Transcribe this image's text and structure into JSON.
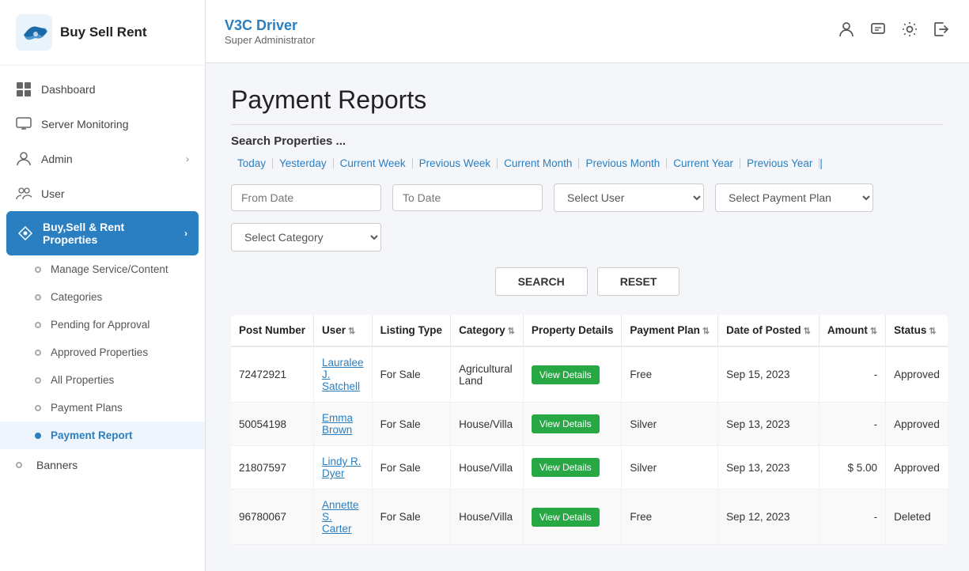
{
  "sidebar": {
    "logo_text": "Buy Sell Rent",
    "nav_items": [
      {
        "id": "dashboard",
        "label": "Dashboard",
        "icon": "grid"
      },
      {
        "id": "server-monitoring",
        "label": "Server Monitoring",
        "icon": "monitor"
      },
      {
        "id": "admin",
        "label": "Admin",
        "icon": "person",
        "has_arrow": true
      },
      {
        "id": "user",
        "label": "User",
        "icon": "people"
      },
      {
        "id": "buy-sell-rent",
        "label": "Buy,Sell & Rent Properties",
        "icon": "tag",
        "active": true,
        "has_arrow": true
      }
    ],
    "sub_items": [
      {
        "id": "manage-service",
        "label": "Manage Service/Content"
      },
      {
        "id": "categories",
        "label": "Categories"
      },
      {
        "id": "pending-approval",
        "label": "Pending for Approval"
      },
      {
        "id": "approved-properties",
        "label": "Approved Properties"
      },
      {
        "id": "all-properties",
        "label": "All Properties"
      },
      {
        "id": "payment-plans",
        "label": "Payment Plans"
      },
      {
        "id": "payment-report",
        "label": "Payment Report",
        "active": true
      }
    ],
    "banners": {
      "label": "Banners"
    }
  },
  "topbar": {
    "name": "V3C Driver",
    "role": "Super Administrator"
  },
  "content": {
    "page_title": "Payment Reports",
    "search_label": "Search Properties ...",
    "date_filters": [
      "Today",
      "Yesterday",
      "Current Week",
      "Previous Week",
      "Current Month",
      "Previous Month",
      "Current Year",
      "Previous Year"
    ],
    "filters": {
      "from_date_placeholder": "From Date",
      "to_date_placeholder": "To Date",
      "select_user_placeholder": "Select User",
      "select_payment_plan_placeholder": "Select Payment Plan",
      "select_category_placeholder": "Select Category"
    },
    "buttons": {
      "search": "SEARCH",
      "reset": "RESET"
    },
    "table": {
      "headers": [
        {
          "label": "Post Number",
          "sortable": false
        },
        {
          "label": "User",
          "sortable": true
        },
        {
          "label": "Listing Type",
          "sortable": false
        },
        {
          "label": "Category",
          "sortable": true
        },
        {
          "label": "Property Details",
          "sortable": false
        },
        {
          "label": "Payment Plan",
          "sortable": true
        },
        {
          "label": "Date of Posted",
          "sortable": true
        },
        {
          "label": "Amount",
          "sortable": true
        },
        {
          "label": "Status",
          "sortable": true
        }
      ],
      "rows": [
        {
          "post_number": "72472921",
          "user": "Lauralee J. Satchell",
          "listing_type": "For Sale",
          "category": "Agricultural Land",
          "property_details": "View Details",
          "payment_plan": "Free",
          "date_posted": "Sep 15, 2023",
          "amount": "-",
          "status": "Approved"
        },
        {
          "post_number": "50054198",
          "user": "Emma Brown",
          "listing_type": "For Sale",
          "category": "House/Villa",
          "property_details": "View Details",
          "payment_plan": "Silver",
          "date_posted": "Sep 13, 2023",
          "amount": "-",
          "status": "Approved"
        },
        {
          "post_number": "21807597",
          "user": "Lindy R. Dyer",
          "listing_type": "For Sale",
          "category": "House/Villa",
          "property_details": "View Details",
          "payment_plan": "Silver",
          "date_posted": "Sep 13, 2023",
          "amount": "$ 5.00",
          "status": "Approved"
        },
        {
          "post_number": "96780067",
          "user": "Annette S. Carter",
          "listing_type": "For Sale",
          "category": "House/Villa",
          "property_details": "View Details",
          "payment_plan": "Free",
          "date_posted": "Sep 12, 2023",
          "amount": "-",
          "status": "Deleted"
        }
      ]
    }
  }
}
